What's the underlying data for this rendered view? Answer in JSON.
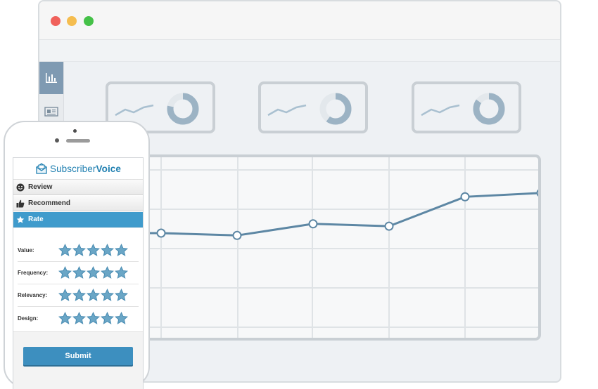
{
  "colors": {
    "accent": "#3f9bcc",
    "chart_line": "#5d87a4",
    "panel_border": "#c9cfd4",
    "sidebar_active": "#7f9ab2",
    "star_fill": "#6aa6c6",
    "window_close": "#f0615b",
    "window_minimize": "#f5bd4f",
    "window_zoom": "#45c148"
  },
  "sidebar": {
    "items": [
      {
        "icon": "bar-chart-icon",
        "active": true
      },
      {
        "icon": "newspaper-icon",
        "active": false
      }
    ]
  },
  "kpi_cards": [
    {
      "sparkline_icon": "sparkline-icon",
      "donut_fraction": 0.78
    },
    {
      "sparkline_icon": "sparkline-icon",
      "donut_fraction": 0.6
    },
    {
      "sparkline_icon": "sparkline-icon",
      "donut_fraction": 0.85
    }
  ],
  "chart_data": {
    "type": "line",
    "title": "",
    "xlabel": "",
    "ylabel": "",
    "grid": true,
    "x": [
      1,
      2,
      3,
      4,
      5,
      6
    ],
    "series": [
      {
        "values": [
          40,
          37,
          52,
          49,
          87,
          92
        ],
        "color": "#5d87a4"
      }
    ],
    "ylim": [
      0,
      100
    ]
  },
  "phone_app": {
    "brand_part1": "Subscriber",
    "brand_part2": "Voice",
    "menu": [
      {
        "icon": "smiley-icon",
        "label": "Review",
        "active": false
      },
      {
        "icon": "thumbs-up-icon",
        "label": "Recommend",
        "active": false
      },
      {
        "icon": "star-icon",
        "label": "Rate",
        "active": true
      }
    ],
    "ratings": [
      {
        "label": "Value:",
        "stars": 5,
        "max": 5
      },
      {
        "label": "Frequency:",
        "stars": 5,
        "max": 5
      },
      {
        "label": "Relevancy:",
        "stars": 5,
        "max": 5
      },
      {
        "label": "Design:",
        "stars": 5,
        "max": 5
      }
    ],
    "submit_label": "Submit"
  }
}
